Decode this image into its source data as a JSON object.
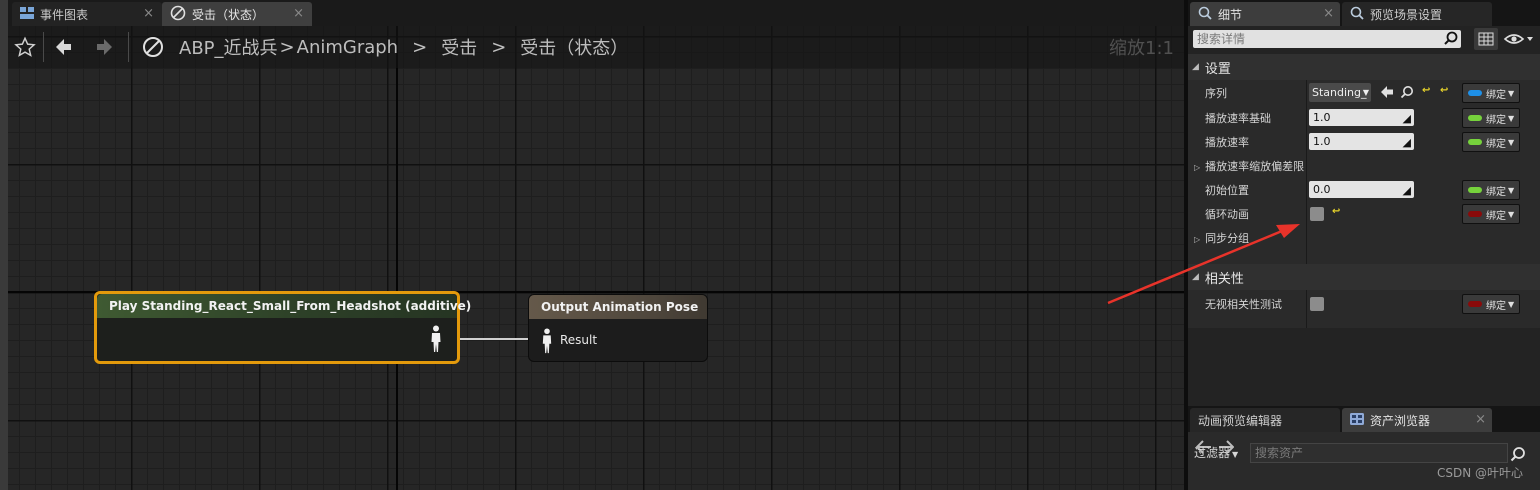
{
  "graph_tabs": [
    {
      "label": "事件图表",
      "icon": "event-graph-icon"
    },
    {
      "label": "受击（状态）",
      "icon": "state-icon"
    }
  ],
  "breadcrumb": [
    "ABP_近战兵",
    "AnimGraph",
    "受击",
    "受击（状态）"
  ],
  "zoom": "缩放1:1",
  "nodes": {
    "play": {
      "title": "Play Standing_React_Small_From_Headshot (additive)"
    },
    "output": {
      "title": "Output Animation Pose",
      "pin": "Result"
    }
  },
  "details_tabs": [
    {
      "label": "细节",
      "icon": "details-icon"
    },
    {
      "label": "预览场景设置",
      "icon": "preview-scene-icon"
    }
  ],
  "details": {
    "search_placeholder": "搜索详情",
    "categories": {
      "settings": "设置",
      "relevancy": "相关性"
    },
    "settings_rows": {
      "sequence": {
        "label": "序列",
        "value": "Standing_"
      },
      "play_rate_basis": {
        "label": "播放速率基础",
        "value": "1.0"
      },
      "play_rate": {
        "label": "播放速率",
        "value": "1.0"
      },
      "play_rate_scale_bias_clamp": {
        "label": "播放速率缩放偏差限"
      },
      "start_position": {
        "label": "初始位置",
        "value": "0.0"
      },
      "loop_animation": {
        "label": "循环动画",
        "checked": false
      },
      "sync_group": {
        "label": "同步分组"
      }
    },
    "relevancy_rows": {
      "ignore_relevancy_test": {
        "label": "无视相关性测试",
        "checked": false
      }
    },
    "bind_label": "绑定"
  },
  "colors": {
    "pin_blue": "#1e90e8",
    "pin_green": "#76d23c",
    "pin_red": "#8a0a0a",
    "node_highlight": "#e39a0c",
    "arrow": "#e8332a"
  },
  "bottom_tabs": [
    {
      "label": "动画预览编辑器"
    },
    {
      "label": "资产浏览器",
      "icon": "content-browser-icon"
    }
  ],
  "asset_browser": {
    "filter_label": "过滤器",
    "search_placeholder": "搜索资产"
  },
  "watermark": "CSDN @叶叶心"
}
